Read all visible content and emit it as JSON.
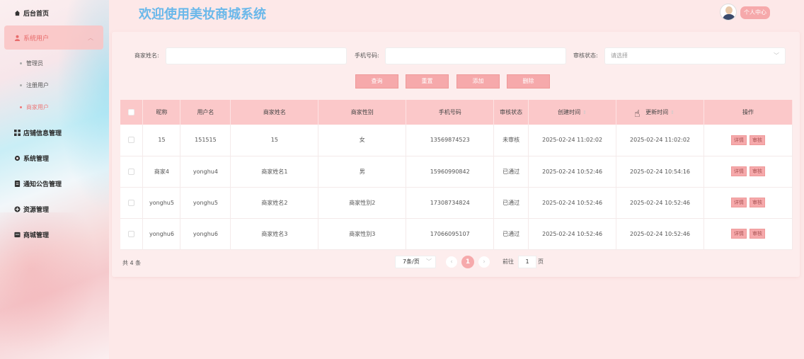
{
  "sidebar": {
    "items": [
      {
        "label": "后台首页",
        "icon": "home-icon"
      },
      {
        "label": "系统用户",
        "icon": "user-icon"
      },
      {
        "label": "店铺信息管理",
        "icon": "grid-icon"
      },
      {
        "label": "系统管理",
        "icon": "gear-icon"
      },
      {
        "label": "通知公告管理",
        "icon": "document-icon"
      },
      {
        "label": "资源管理",
        "icon": "plus-circle-icon"
      },
      {
        "label": "商城管理",
        "icon": "box-icon"
      }
    ],
    "sub_items": [
      "管理员",
      "注册用户",
      "商家用户"
    ]
  },
  "header": {
    "title": "欢迎使用美妆商城系统",
    "profile": "个人中心"
  },
  "filters": {
    "name_label": "商家姓名:",
    "phone_label": "手机号码:",
    "status_label": "审核状态:",
    "status_placeholder": "请选择"
  },
  "buttons": {
    "query": "查询",
    "reset": "重置",
    "add": "添加",
    "delete": "删除"
  },
  "table": {
    "headers": [
      "昵称",
      "用户名",
      "商家姓名",
      "商家性别",
      "手机号码",
      "审核状态",
      "创建时间",
      "更新时间",
      "操作"
    ],
    "rows": [
      [
        "15",
        "151515",
        "15",
        "女",
        "13569874523",
        "未审核",
        "2025-02-24 11:02:02",
        "2025-02-24 11:02:02"
      ],
      [
        "商家4",
        "yonghu4",
        "商家姓名1",
        "男",
        "15960990842",
        "已通过",
        "2025-02-24 10:52:46",
        "2025-02-24 10:54:16"
      ],
      [
        "yonghu5",
        "yonghu5",
        "商家姓名2",
        "商家性别2",
        "17308734824",
        "已通过",
        "2025-02-24 10:52:46",
        "2025-02-24 10:52:46"
      ],
      [
        "yonghu6",
        "yonghu6",
        "商家姓名3",
        "商家性别3",
        "17066095107",
        "已通过",
        "2025-02-24 10:52:46",
        "2025-02-24 10:52:46"
      ]
    ],
    "actions": {
      "detail": "详情",
      "review": "审核"
    }
  },
  "pagination": {
    "total": "共 4 条",
    "page_size": "7条/页",
    "current_page": "1",
    "goto_prefix": "前往",
    "goto_value": "1",
    "goto_suffix": "页"
  },
  "colors": {
    "accent": "#f6a9ab",
    "title": "#6ab8ea",
    "header_row": "#fbc8c9"
  }
}
